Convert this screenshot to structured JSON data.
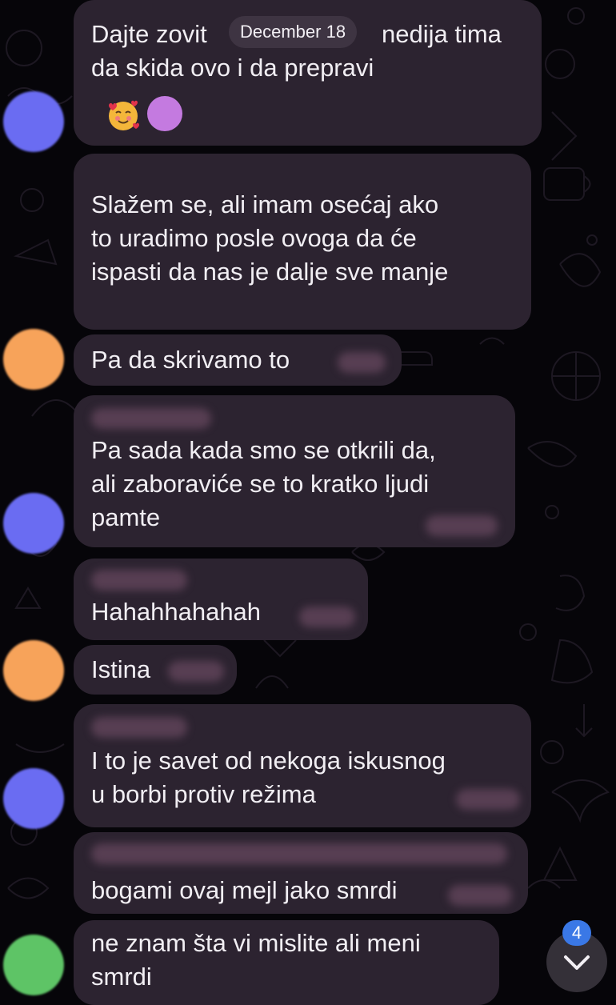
{
  "chat": {
    "date_label": "December 18",
    "unread_badge": "4",
    "messages": [
      {
        "lines": [
          "Dajte zovit",
          "da skida ovo i da  prepravi"
        ],
        "tail_text": "nedija tima",
        "reaction": "smiling-face-with-hearts"
      },
      {
        "lines": [
          "Slažem se, ali imam osećaj ako",
          "to uradimo posle ovoga da će",
          "ispasti da nas je dalje sve manje"
        ]
      },
      {
        "lines": [
          "Pa da skrivamo to"
        ]
      },
      {
        "lines": [
          "Pa sada kada smo se otkrili da,",
          "ali zaboraviće se to kratko ljudi",
          "pamte"
        ]
      },
      {
        "lines": [
          "Hahahhahahah"
        ]
      },
      {
        "lines": [
          "Istina"
        ]
      },
      {
        "lines": [
          "I to je savet od nekoga iskusnog",
          "u borbi protiv režima"
        ]
      },
      {
        "lines": [
          "bogami ovaj mejl jako smrdi"
        ]
      },
      {
        "lines": [
          "ne znam šta vi mislite ali meni",
          "smrdi"
        ]
      }
    ],
    "avatars": [
      {
        "color": "#6a6cf2"
      },
      {
        "color": "#f7a35a"
      },
      {
        "color": "#6a6cf2"
      },
      {
        "color": "#f7a35a"
      },
      {
        "color": "#6a6cf2"
      },
      {
        "color": "#5ec466"
      }
    ]
  },
  "icons": {
    "scroll_down": "chevron-down-icon",
    "reaction": "smiling-face-with-hearts-icon"
  }
}
